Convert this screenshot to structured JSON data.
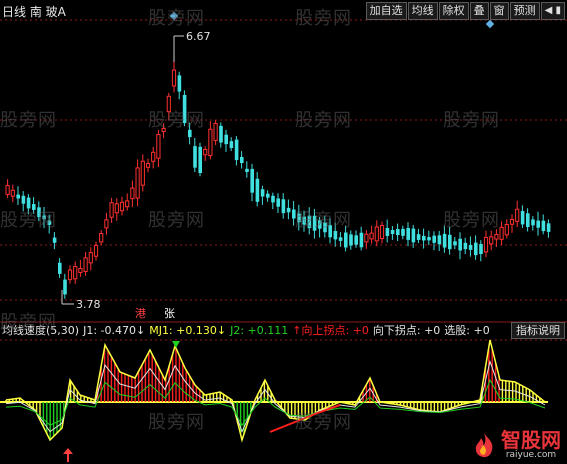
{
  "header": {
    "period": "日线",
    "stock_name": "南 玻A"
  },
  "toolbar": {
    "buttons": [
      "加自选",
      "均线",
      "除权",
      "叠",
      "窗",
      "预测"
    ],
    "arrows": "◀ ▮"
  },
  "price_labels": {
    "high": "6.67",
    "low": "3.78"
  },
  "tags": {
    "left": "港",
    "right": "张"
  },
  "indicator": {
    "name": "均线速度(5,30)",
    "j1": "J1: -0.470↓",
    "mj1": "MJ1: +0.130↓",
    "j2": "J2: +0.111",
    "up": "↑向上拐点: +0",
    "down": "向下拐点: +0",
    "pick": "选股: +0",
    "help": "指标说明"
  },
  "watermark": "股旁网",
  "logo": {
    "main": "智股网",
    "sub": "raiyue.com"
  },
  "colors": {
    "up": "#ff3030",
    "down": "#40e0e0",
    "white": "#e6e6e6",
    "yellow": "#ffff40",
    "green": "#20d020",
    "red": "#ff2020",
    "magenta": "#ff40ff",
    "grid": "#8b1a1a"
  }
}
